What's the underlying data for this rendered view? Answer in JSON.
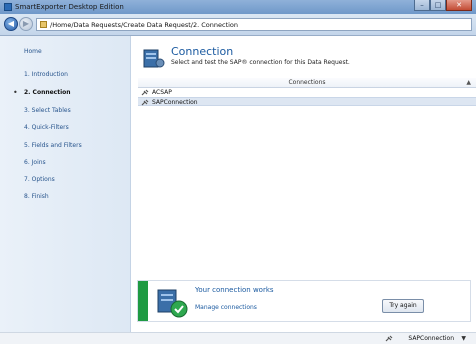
{
  "window": {
    "title": "SmartExporter Desktop Edition"
  },
  "nav": {
    "address": "/Home/Data Requests/Create Data Request/2. Connection"
  },
  "sidebar": {
    "items": [
      {
        "label": "Home"
      },
      {
        "label": "1. Introduction"
      },
      {
        "label": "2. Connection",
        "active": true
      },
      {
        "label": "3. Select Tables"
      },
      {
        "label": "4. Quick-Filters"
      },
      {
        "label": "5. Fields and Filters"
      },
      {
        "label": "6. Joins"
      },
      {
        "label": "7. Options"
      },
      {
        "label": "8. Finish"
      }
    ]
  },
  "header": {
    "title": "Connection",
    "description": "Select and test the SAP® connection for this Data Request."
  },
  "grid": {
    "column": "Connections",
    "rows": [
      {
        "label": "ACSAP"
      },
      {
        "label": "SAPConnection",
        "selected": true
      }
    ]
  },
  "status_panel": {
    "title": "Your connection works",
    "link": "Manage connections",
    "button": "Try again",
    "accent": "#1f9a43"
  },
  "statusbar": {
    "connection": "SAPConnection"
  }
}
